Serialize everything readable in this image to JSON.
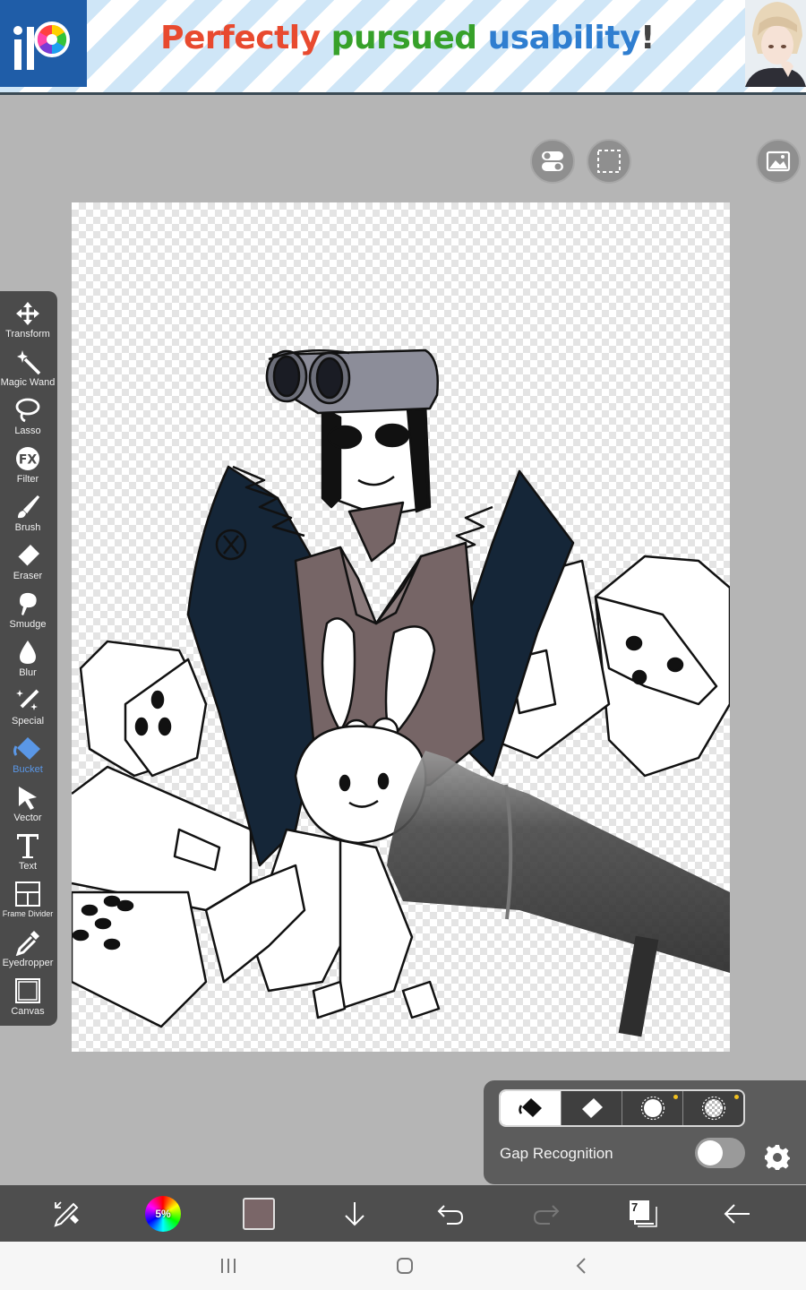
{
  "banner": {
    "logo_text": "iP",
    "headline_parts": [
      "Perfectly",
      "pursued",
      "usability",
      "!"
    ]
  },
  "toolbar": {
    "items": [
      {
        "label": "Transform",
        "icon": "move-arrows-icon"
      },
      {
        "label": "Magic Wand",
        "icon": "magic-wand-icon"
      },
      {
        "label": "Lasso",
        "icon": "lasso-icon"
      },
      {
        "label": "Filter",
        "icon": "fx-icon"
      },
      {
        "label": "Brush",
        "icon": "brush-icon"
      },
      {
        "label": "Eraser",
        "icon": "eraser-icon"
      },
      {
        "label": "Smudge",
        "icon": "smudge-icon"
      },
      {
        "label": "Blur",
        "icon": "droplet-icon"
      },
      {
        "label": "Special",
        "icon": "special-pen-icon"
      },
      {
        "label": "Bucket",
        "icon": "bucket-icon",
        "active": true
      },
      {
        "label": "Vector",
        "icon": "cursor-arrow-icon"
      },
      {
        "label": "Text",
        "icon": "text-t-icon"
      },
      {
        "label": "Frame Divider",
        "icon": "frame-divider-icon"
      },
      {
        "label": "Eyedropper",
        "icon": "eyedropper-icon"
      },
      {
        "label": "Canvas",
        "icon": "canvas-icon"
      }
    ]
  },
  "bucket_panel": {
    "gap_recognition_label": "Gap Recognition",
    "gap_recognition_on": false,
    "modes": [
      "fill",
      "erase",
      "select-area",
      "transparent-area"
    ]
  },
  "bottom_bar": {
    "brush_size_text": "5%",
    "current_color": "#7a6668",
    "layer_count": "7"
  },
  "colors": {
    "accent": "#5a97e6",
    "toolbar_bg": "#4b4b4b",
    "workspace_bg": "#b5b5b5"
  }
}
